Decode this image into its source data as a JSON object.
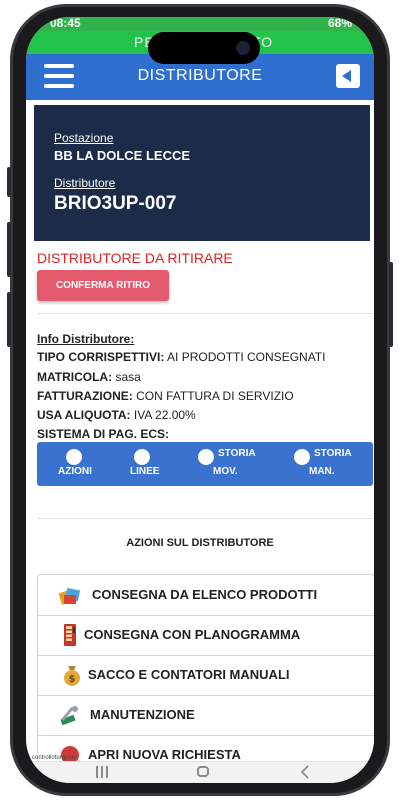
{
  "status": {
    "time": "08:45",
    "right": "68%"
  },
  "banner": {
    "left": "PE",
    "right": "TO"
  },
  "header": {
    "title": "DISTRIBUTORE"
  },
  "card": {
    "postazione_label": "Postazione",
    "postazione_value": "BB LA DOLCE LECCE",
    "distributore_label": "Distributore",
    "distributore_value": "BRIO3UP-007"
  },
  "removal": {
    "notice": "DISTRIBUTORE DA RITIRARE",
    "confirm_label": "CONFERMA RITIRO"
  },
  "info": {
    "title": "Info Distributore:",
    "rows": [
      {
        "key": "TIPO CORRISPETTIVI:",
        "value": "AI PRODOTTI CONSEGNATI"
      },
      {
        "key": "MATRICOLA:",
        "value": "sasa"
      },
      {
        "key": "FATTURAZIONE:",
        "value": "CON FATTURA DI SERVIZIO"
      },
      {
        "key": "USA ALIQUOTA:",
        "value": "IVA 22.00%"
      },
      {
        "key": "SISTEMA DI PAG. ECS:",
        "value": ""
      }
    ]
  },
  "tabs": [
    {
      "line1": "",
      "line2": "AZIONI"
    },
    {
      "line1": "",
      "line2": "LINEE"
    },
    {
      "line1": "STORIA",
      "line2": "MOV."
    },
    {
      "line1": "STORIA",
      "line2": "MAN."
    }
  ],
  "actions_section": {
    "title": "AZIONI SUL DISTRIBUTORE",
    "items": [
      {
        "label": "CONSEGNA DA ELENCO PRODOTTI",
        "icon": "products-box-icon"
      },
      {
        "label": "CONSEGNA CON PLANOGRAMMA",
        "icon": "vending-machine-icon"
      },
      {
        "label": "SACCO E CONTATORI MANUALI",
        "icon": "money-bag-icon"
      },
      {
        "label": "MANUTENZIONE",
        "icon": "wrench-tools-icon"
      },
      {
        "label": "APRI NUOVA RICHIESTA",
        "icon": "new-request-icon"
      }
    ]
  },
  "footer": {
    "caption": "controllofurgone"
  },
  "colors": {
    "header": "#2f6fd0",
    "banner": "#23c24a",
    "card": "#1c2b47",
    "danger": "#d22222",
    "button": "#e25a6b"
  }
}
